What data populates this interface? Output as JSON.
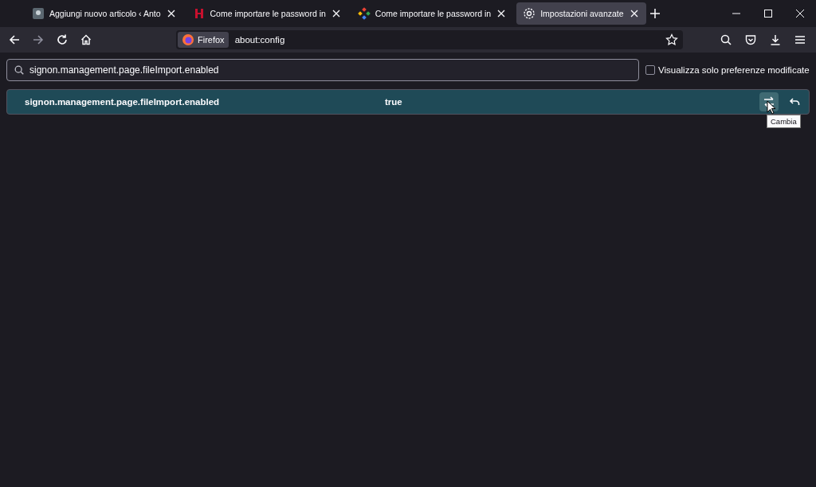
{
  "tabs": [
    {
      "label": "Aggiungi nuovo articolo ‹ Anto",
      "selected": false
    },
    {
      "label": "Come importare le password in",
      "selected": false
    },
    {
      "label": "Come importare le password in",
      "selected": false
    },
    {
      "label": "Impostazioni avanzate",
      "selected": true
    }
  ],
  "urlbar": {
    "identity": "Firefox",
    "url": "about:config"
  },
  "search": {
    "value": "signon.management.page.fileImport.enabled"
  },
  "modified_only": {
    "label": "Visualizza solo preferenze modificate",
    "checked": false
  },
  "prefs": [
    {
      "name": "signon.management.page.fileImport.enabled",
      "value": "true",
      "selected": true
    }
  ],
  "tooltip": "Cambia"
}
